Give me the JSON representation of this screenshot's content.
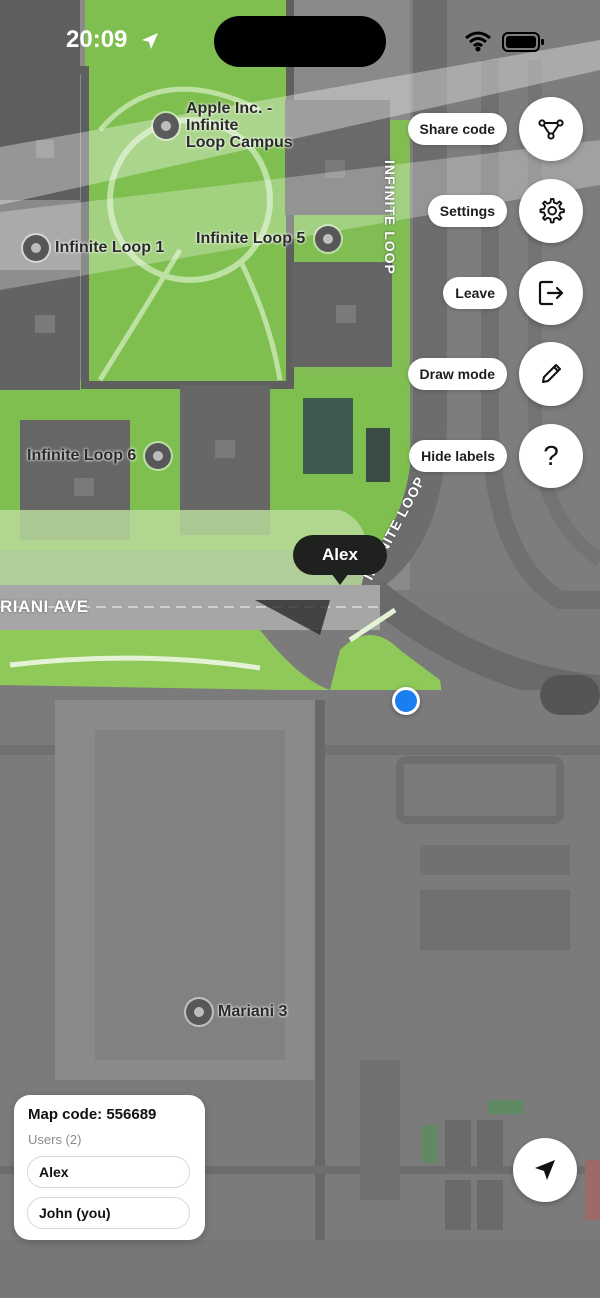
{
  "status_bar": {
    "time": "20:09"
  },
  "map": {
    "labels": {
      "apple_campus": "Apple Inc. -\nInfinite\nLoop Campus",
      "infinite_loop_1": "Infinite Loop 1",
      "infinite_loop_5": "Infinite Loop 5",
      "infinite_loop_6": "Infinite Loop 6",
      "mariani_3": "Mariani 3",
      "mariani_ave": "RIANI AVE",
      "infinite_loop_road_top": "INFINITE LOOP",
      "infinite_loop_road_curve": "INFINITE LOOP"
    },
    "colors": {
      "user_location": "#1a7ef0",
      "park": "#8fc95a"
    }
  },
  "actions": [
    {
      "id": "share",
      "label": "Share code",
      "icon": "share-nodes-icon"
    },
    {
      "id": "settings",
      "label": "Settings",
      "icon": "gear-icon"
    },
    {
      "id": "leave",
      "label": "Leave",
      "icon": "exit-icon"
    },
    {
      "id": "draw",
      "label": "Draw mode",
      "icon": "pencil-icon"
    },
    {
      "id": "labels",
      "label": "Hide labels",
      "icon": "question-icon"
    }
  ],
  "marker": {
    "name": "Alex"
  },
  "panel": {
    "map_code": "Map code: 556689",
    "users_heading": "Users (2)",
    "users": [
      "Alex",
      "John (you)"
    ]
  }
}
